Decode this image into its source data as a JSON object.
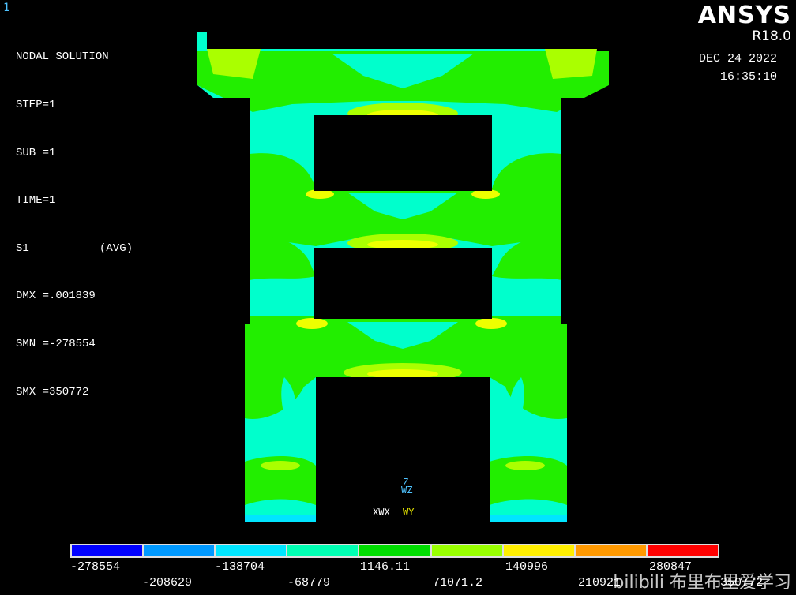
{
  "window_number": "1",
  "info": {
    "title": "NODAL SOLUTION",
    "step": "STEP=1",
    "sub": "SUB =1",
    "time": "TIME=1",
    "result": "S1",
    "avg": "(AVG)",
    "dmx": "DMX =.001839",
    "smn": "SMN =-278554",
    "smx": "SMX =350772"
  },
  "brand": {
    "name": "ANSYS",
    "version": "R18.0"
  },
  "timestamp": {
    "date": "DEC 24 2022",
    "time": "16:35:10"
  },
  "triad": {
    "z": "Z",
    "wz": "WZ",
    "xwx": "XWX",
    "wy": "WY"
  },
  "legend": {
    "colors": [
      "#0000ff",
      "#0099ff",
      "#00e5ff",
      "#00ffb3",
      "#00dd00",
      "#99ff00",
      "#ffee00",
      "#ff9900",
      "#ff0000"
    ],
    "upper_labels": [
      "-278554",
      "-138704",
      "1146.11",
      "140996",
      "280847"
    ],
    "lower_labels": [
      "-208629",
      "-68779",
      "71071.2",
      "210921",
      "350772"
    ]
  },
  "watermark": "bilibili 布里布里爱学习",
  "contour_colors": {
    "cyan": "#00ffcc",
    "green": "#22ee00",
    "yellowgreen": "#aaff00",
    "yellow": "#eeff00"
  }
}
